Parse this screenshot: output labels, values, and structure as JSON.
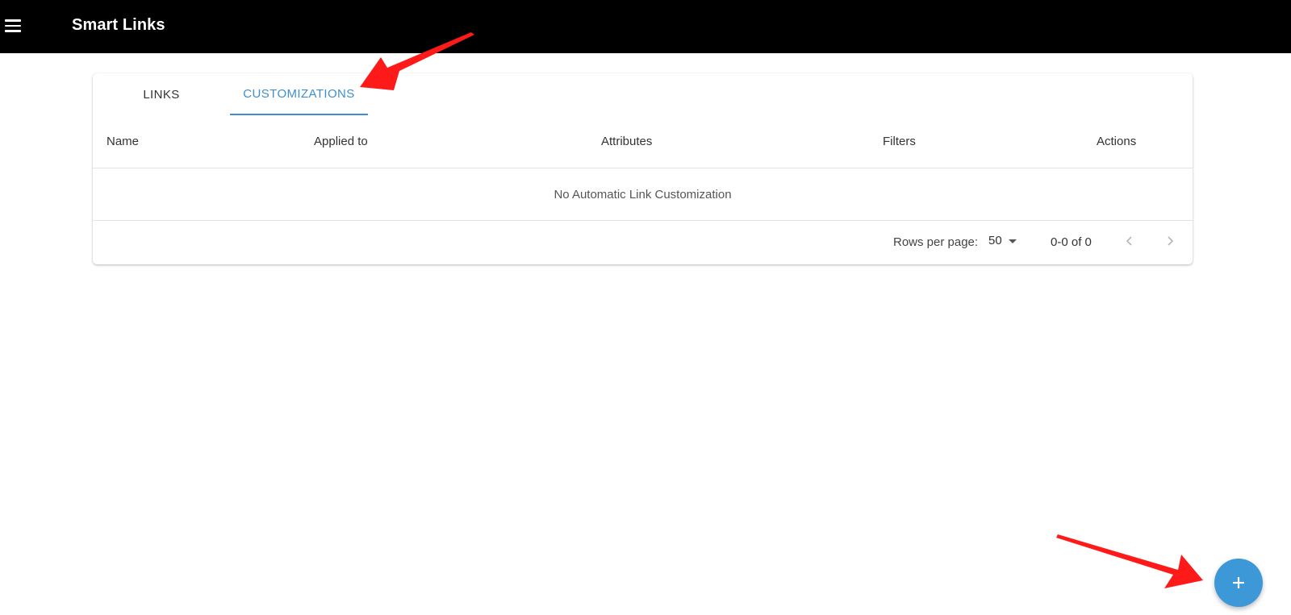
{
  "appbar": {
    "title": "Smart Links"
  },
  "tabs": [
    {
      "label": "LINKS",
      "active": false
    },
    {
      "label": "CUSTOMIZATIONS",
      "active": true
    }
  ],
  "table": {
    "columns": [
      "Name",
      "Applied to",
      "Attributes",
      "Filters",
      "Actions"
    ],
    "empty_message": "No Automatic Link Customization"
  },
  "pagination": {
    "rows_per_page_label": "Rows per page:",
    "rows_per_page_value": "50",
    "range_label": "0-0 of 0"
  },
  "colors": {
    "accent": "#3d8fd1",
    "fab": "#3d98d8",
    "appbar": "#000000",
    "annotation_arrow": "#ff1a1a"
  },
  "icons": {
    "menu": "menu-icon",
    "prev": "chevron-left-icon",
    "next": "chevron-right-icon",
    "fab": "plus-icon"
  }
}
